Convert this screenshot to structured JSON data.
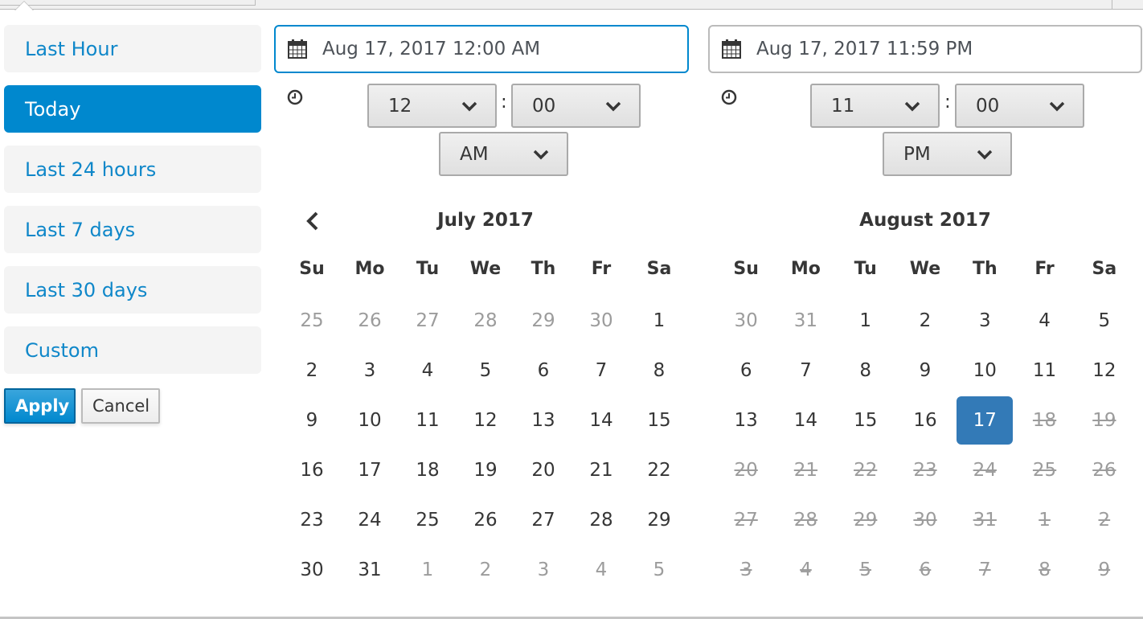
{
  "colors": {
    "accent": "#0088ce",
    "selected_day": "#337ab7",
    "link": "#0f87c9",
    "muted": "#9c9c9c"
  },
  "ranges": [
    {
      "label": "Last Hour",
      "active": false
    },
    {
      "label": "Today",
      "active": true
    },
    {
      "label": "Last 24 hours",
      "active": false
    },
    {
      "label": "Last 7 days",
      "active": false
    },
    {
      "label": "Last 30 days",
      "active": false
    },
    {
      "label": "Custom",
      "active": false
    }
  ],
  "actions": {
    "apply_label": "Apply",
    "cancel_label": "Cancel"
  },
  "start": {
    "date_value": "Aug 17, 2017 12:00 AM",
    "hour": "12",
    "minute": "00",
    "ampm": "AM",
    "calendar_icon": "calendar-icon",
    "clock_icon": "clock-icon"
  },
  "end": {
    "date_value": "Aug 17, 2017 11:59 PM",
    "hour": "11",
    "minute": "00",
    "ampm": "PM",
    "calendar_icon": "calendar-icon",
    "clock_icon": "clock-icon"
  },
  "time_separator": ":",
  "weekdays": [
    "Su",
    "Mo",
    "Tu",
    "We",
    "Th",
    "Fr",
    "Sa"
  ],
  "calendars": [
    {
      "title": "July 2017",
      "has_prev": true,
      "weeks": [
        [
          {
            "d": "25",
            "s": "other"
          },
          {
            "d": "26",
            "s": "other"
          },
          {
            "d": "27",
            "s": "other"
          },
          {
            "d": "28",
            "s": "other"
          },
          {
            "d": "29",
            "s": "other"
          },
          {
            "d": "30",
            "s": "other"
          },
          {
            "d": "1",
            "s": ""
          }
        ],
        [
          {
            "d": "2",
            "s": ""
          },
          {
            "d": "3",
            "s": ""
          },
          {
            "d": "4",
            "s": ""
          },
          {
            "d": "5",
            "s": ""
          },
          {
            "d": "6",
            "s": ""
          },
          {
            "d": "7",
            "s": ""
          },
          {
            "d": "8",
            "s": ""
          }
        ],
        [
          {
            "d": "9",
            "s": ""
          },
          {
            "d": "10",
            "s": ""
          },
          {
            "d": "11",
            "s": ""
          },
          {
            "d": "12",
            "s": ""
          },
          {
            "d": "13",
            "s": ""
          },
          {
            "d": "14",
            "s": ""
          },
          {
            "d": "15",
            "s": ""
          }
        ],
        [
          {
            "d": "16",
            "s": ""
          },
          {
            "d": "17",
            "s": ""
          },
          {
            "d": "18",
            "s": ""
          },
          {
            "d": "19",
            "s": ""
          },
          {
            "d": "20",
            "s": ""
          },
          {
            "d": "21",
            "s": ""
          },
          {
            "d": "22",
            "s": ""
          }
        ],
        [
          {
            "d": "23",
            "s": ""
          },
          {
            "d": "24",
            "s": ""
          },
          {
            "d": "25",
            "s": ""
          },
          {
            "d": "26",
            "s": ""
          },
          {
            "d": "27",
            "s": ""
          },
          {
            "d": "28",
            "s": ""
          },
          {
            "d": "29",
            "s": ""
          }
        ],
        [
          {
            "d": "30",
            "s": ""
          },
          {
            "d": "31",
            "s": ""
          },
          {
            "d": "1",
            "s": "other"
          },
          {
            "d": "2",
            "s": "other"
          },
          {
            "d": "3",
            "s": "other"
          },
          {
            "d": "4",
            "s": "other"
          },
          {
            "d": "5",
            "s": "other"
          }
        ]
      ]
    },
    {
      "title": "August 2017",
      "has_prev": false,
      "weeks": [
        [
          {
            "d": "30",
            "s": "other"
          },
          {
            "d": "31",
            "s": "other"
          },
          {
            "d": "1",
            "s": ""
          },
          {
            "d": "2",
            "s": ""
          },
          {
            "d": "3",
            "s": ""
          },
          {
            "d": "4",
            "s": ""
          },
          {
            "d": "5",
            "s": ""
          }
        ],
        [
          {
            "d": "6",
            "s": ""
          },
          {
            "d": "7",
            "s": ""
          },
          {
            "d": "8",
            "s": ""
          },
          {
            "d": "9",
            "s": ""
          },
          {
            "d": "10",
            "s": ""
          },
          {
            "d": "11",
            "s": ""
          },
          {
            "d": "12",
            "s": ""
          }
        ],
        [
          {
            "d": "13",
            "s": ""
          },
          {
            "d": "14",
            "s": ""
          },
          {
            "d": "15",
            "s": ""
          },
          {
            "d": "16",
            "s": ""
          },
          {
            "d": "17",
            "s": "selected"
          },
          {
            "d": "18",
            "s": "disabled"
          },
          {
            "d": "19",
            "s": "disabled"
          }
        ],
        [
          {
            "d": "20",
            "s": "disabled"
          },
          {
            "d": "21",
            "s": "disabled"
          },
          {
            "d": "22",
            "s": "disabled"
          },
          {
            "d": "23",
            "s": "disabled"
          },
          {
            "d": "24",
            "s": "disabled"
          },
          {
            "d": "25",
            "s": "disabled"
          },
          {
            "d": "26",
            "s": "disabled"
          }
        ],
        [
          {
            "d": "27",
            "s": "disabled"
          },
          {
            "d": "28",
            "s": "disabled"
          },
          {
            "d": "29",
            "s": "disabled"
          },
          {
            "d": "30",
            "s": "disabled"
          },
          {
            "d": "31",
            "s": "disabled"
          },
          {
            "d": "1",
            "s": "disabled"
          },
          {
            "d": "2",
            "s": "disabled"
          }
        ],
        [
          {
            "d": "3",
            "s": "disabled"
          },
          {
            "d": "4",
            "s": "disabled"
          },
          {
            "d": "5",
            "s": "disabled"
          },
          {
            "d": "6",
            "s": "disabled"
          },
          {
            "d": "7",
            "s": "disabled"
          },
          {
            "d": "8",
            "s": "disabled"
          },
          {
            "d": "9",
            "s": "disabled"
          }
        ]
      ]
    }
  ]
}
